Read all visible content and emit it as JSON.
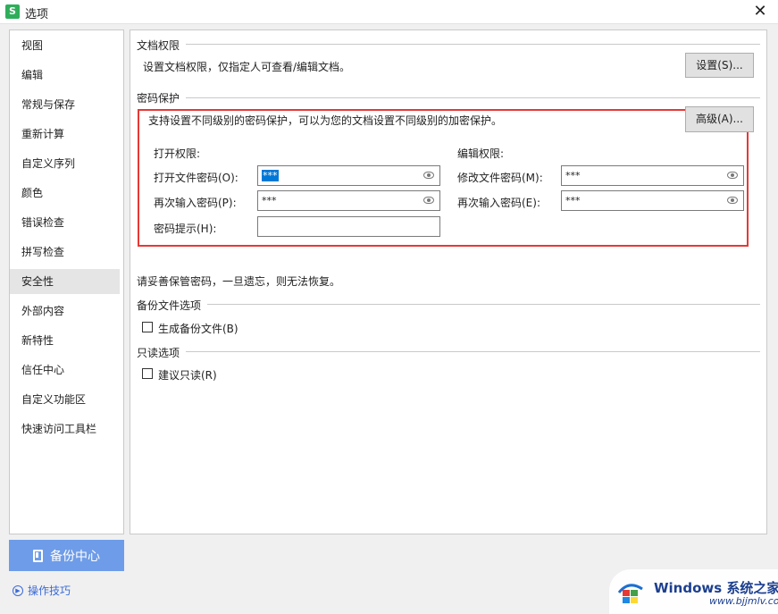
{
  "window": {
    "icon_letter": "S",
    "title": "选项",
    "close": "✕"
  },
  "sidebar": {
    "items": [
      {
        "label": "视图"
      },
      {
        "label": "编辑"
      },
      {
        "label": "常规与保存"
      },
      {
        "label": "重新计算"
      },
      {
        "label": "自定义序列"
      },
      {
        "label": "颜色"
      },
      {
        "label": "错误检查"
      },
      {
        "label": "拼写检查"
      },
      {
        "label": "安全性",
        "active": true
      },
      {
        "label": "外部内容"
      },
      {
        "label": "新特性"
      },
      {
        "label": "信任中心"
      },
      {
        "label": "自定义功能区"
      },
      {
        "label": "快速访问工具栏"
      }
    ],
    "backup_center": "备份中心",
    "tips_link": "操作技巧"
  },
  "doc_permission": {
    "title": "文档权限",
    "desc": "设置文档权限，仅指定人可查看/编辑文档。",
    "settings_button": "设置(S)..."
  },
  "password": {
    "title": "密码保护",
    "desc": "支持设置不同级别的密码保护，可以为您的文档设置不同级别的加密保护。",
    "advanced_button": "高级(A)...",
    "open": {
      "heading": "打开权限:",
      "password_label": "打开文件密码(O):",
      "password_value": "***",
      "confirm_label": "再次输入密码(P):",
      "confirm_value": "***",
      "hint_label": "密码提示(H):",
      "hint_value": ""
    },
    "edit": {
      "heading": "编辑权限:",
      "password_label": "修改文件密码(M):",
      "password_value": "***",
      "confirm_label": "再次输入密码(E):",
      "confirm_value": "***"
    },
    "warning": "请妥善保管密码，一旦遗忘，则无法恢复。"
  },
  "backup": {
    "title": "备份文件选项",
    "generate_label": "生成备份文件(B)",
    "checked": false
  },
  "readonly": {
    "title": "只读选项",
    "suggest_label": "建议只读(R)",
    "checked": false
  },
  "watermark": {
    "brand": "Windows 系统之家",
    "url": "www.bjjmlv.com"
  },
  "colors": {
    "accent_button": "#6e9ce8",
    "highlight_box": "#e53935",
    "link": "#3a6bd8"
  }
}
